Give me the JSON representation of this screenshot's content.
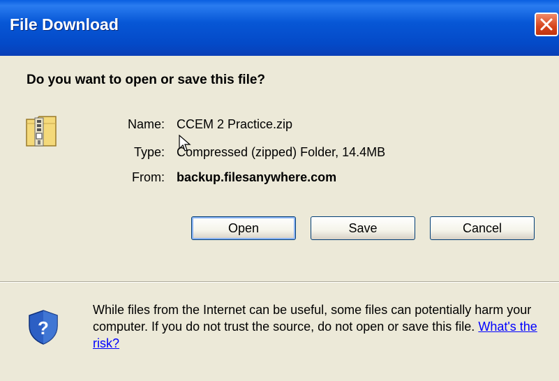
{
  "window": {
    "title": "File Download",
    "close_label": "Close"
  },
  "dialog": {
    "question": "Do you want to open or save this file?",
    "fields": {
      "name_label": "Name:",
      "name_value": "CCEM 2 Practice.zip",
      "type_label": "Type:",
      "type_value": "Compressed (zipped) Folder, 14.4MB",
      "from_label": "From:",
      "from_value": "backup.filesanywhere.com"
    },
    "buttons": {
      "open": "Open",
      "save": "Save",
      "cancel": "Cancel"
    }
  },
  "warning": {
    "text": "While files from the Internet can be useful, some files can potentially harm your computer. If you do not trust the source, do not open or save this file.",
    "link": "What's the risk?"
  },
  "icons": {
    "file": "zip-folder-icon",
    "security": "shield-question-icon",
    "close": "close-icon"
  },
  "colors": {
    "titlebar": "#0554d4",
    "close": "#d6451d",
    "background": "#ece9d8",
    "link": "#0000ff"
  }
}
